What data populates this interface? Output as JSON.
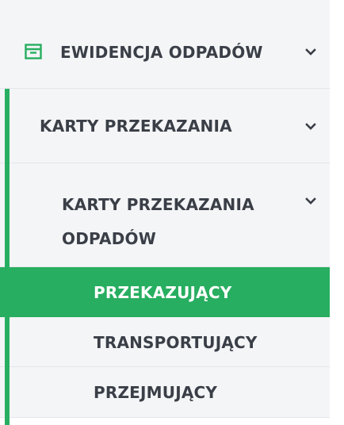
{
  "menu": {
    "level0": {
      "label": "EWIDENCJA ODPADÓW",
      "icon": "archive-box-icon"
    },
    "level1": {
      "label": "KARTY PRZEKAZANIA"
    },
    "level2": {
      "label": "KARTY PRZEKAZANIA ODPADÓW"
    },
    "items": [
      {
        "label": "PRZEKAZUJĄCY",
        "active": true
      },
      {
        "label": "TRANSPORTUJĄCY",
        "active": false
      },
      {
        "label": "PRZEJMUJĄCY",
        "active": false
      }
    ]
  },
  "colors": {
    "accent": "#27ae60",
    "background": "#f4f5f7",
    "text": "#3a3f47",
    "active_text": "#ffffff"
  }
}
